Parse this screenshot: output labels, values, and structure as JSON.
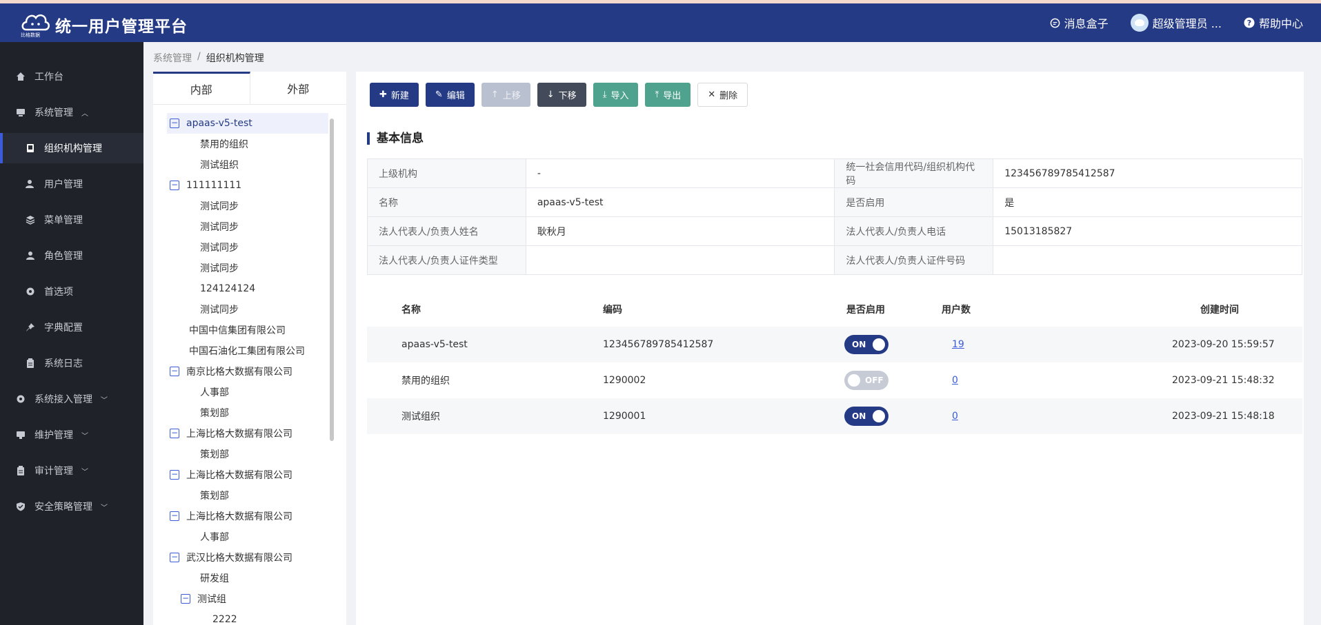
{
  "header": {
    "logo_text": "比格数据",
    "title": "统一用户管理平台",
    "messages": "消息盒子",
    "user": "超级管理员 ...",
    "help": "帮助中心"
  },
  "sidebar": {
    "items": [
      {
        "label": "工作台",
        "icon": "home-icon"
      },
      {
        "label": "系统管理",
        "icon": "monitor-icon"
      },
      {
        "label": "组织机构管理",
        "icon": "book-icon"
      },
      {
        "label": "用户管理",
        "icon": "users-icon"
      },
      {
        "label": "菜单管理",
        "icon": "layers-icon"
      },
      {
        "label": "角色管理",
        "icon": "user-icon"
      },
      {
        "label": "首选项",
        "icon": "gear-icon"
      },
      {
        "label": "字典配置",
        "icon": "pin-icon"
      },
      {
        "label": "系统日志",
        "icon": "clipboard-icon"
      },
      {
        "label": "系统接入管理",
        "icon": "gear-icon"
      },
      {
        "label": "维护管理",
        "icon": "tool-icon"
      },
      {
        "label": "审计管理",
        "icon": "clipboard-icon"
      },
      {
        "label": "安全策略管理",
        "icon": "shield-icon"
      }
    ]
  },
  "breadcrumb": {
    "parent": "系统管理",
    "separator": "/",
    "current": "组织机构管理"
  },
  "tree_tabs": {
    "internal": "内部",
    "external": "外部"
  },
  "tree": [
    {
      "label": "apaas-v5-test",
      "toggle": "−"
    },
    {
      "label": "禁用的组织"
    },
    {
      "label": "测试组织"
    },
    {
      "label": "111111111",
      "toggle": "−"
    },
    {
      "label": "测试同步"
    },
    {
      "label": "测试同步"
    },
    {
      "label": "测试同步"
    },
    {
      "label": "测试同步"
    },
    {
      "label": "124124124"
    },
    {
      "label": "测试同步"
    },
    {
      "label": "中国中信集团有限公司"
    },
    {
      "label": "中国石油化工集团有限公司"
    },
    {
      "label": "南京比格大数据有限公司",
      "toggle": "−"
    },
    {
      "label": "人事部"
    },
    {
      "label": "策划部"
    },
    {
      "label": "上海比格大数据有限公司",
      "toggle": "−"
    },
    {
      "label": "策划部"
    },
    {
      "label": "上海比格大数据有限公司",
      "toggle": "−"
    },
    {
      "label": "策划部"
    },
    {
      "label": "上海比格大数据有限公司",
      "toggle": "−"
    },
    {
      "label": "人事部"
    },
    {
      "label": "武汉比格大数据有限公司",
      "toggle": "−"
    },
    {
      "label": "研发组"
    },
    {
      "label": "测试组",
      "toggle": "−"
    },
    {
      "label": "2222"
    }
  ],
  "toolbar": {
    "new": "新建",
    "edit": "编辑",
    "move_up": "上移",
    "move_down": "下移",
    "import": "导入",
    "export": "导出",
    "delete": "删除"
  },
  "basic_info": {
    "title": "基本信息",
    "rows": [
      {
        "l1": "上级机构",
        "v1": "-",
        "l2": "统一社会信用代码/组织机构代码",
        "v2": "123456789785412587"
      },
      {
        "l1": "名称",
        "v1": "apaas-v5-test",
        "l2": "是否启用",
        "v2": "是"
      },
      {
        "l1": "法人代表人/负责人姓名",
        "v1": "耿秋月",
        "l2": "法人代表人/负责人电话",
        "v2": "15013185827"
      },
      {
        "l1": "法人代表人/负责人证件类型",
        "v1": "",
        "l2": "法人代表人/负责人证件号码",
        "v2": ""
      }
    ]
  },
  "table": {
    "headers": {
      "name": "名称",
      "code": "编码",
      "enabled": "是否启用",
      "users": "用户数",
      "created": "创建时间"
    },
    "rows": [
      {
        "name": "apaas-v5-test",
        "code": "123456789785412587",
        "enabled": true,
        "switch": "ON",
        "users": "19",
        "created": "2023-09-20 15:59:57"
      },
      {
        "name": "禁用的组织",
        "code": "1290002",
        "enabled": false,
        "switch": "OFF",
        "users": "0",
        "created": "2023-09-21 15:48:32"
      },
      {
        "name": "测试组织",
        "code": "1290001",
        "enabled": true,
        "switch": "ON",
        "users": "0",
        "created": "2023-09-21 15:48:18"
      }
    ]
  }
}
